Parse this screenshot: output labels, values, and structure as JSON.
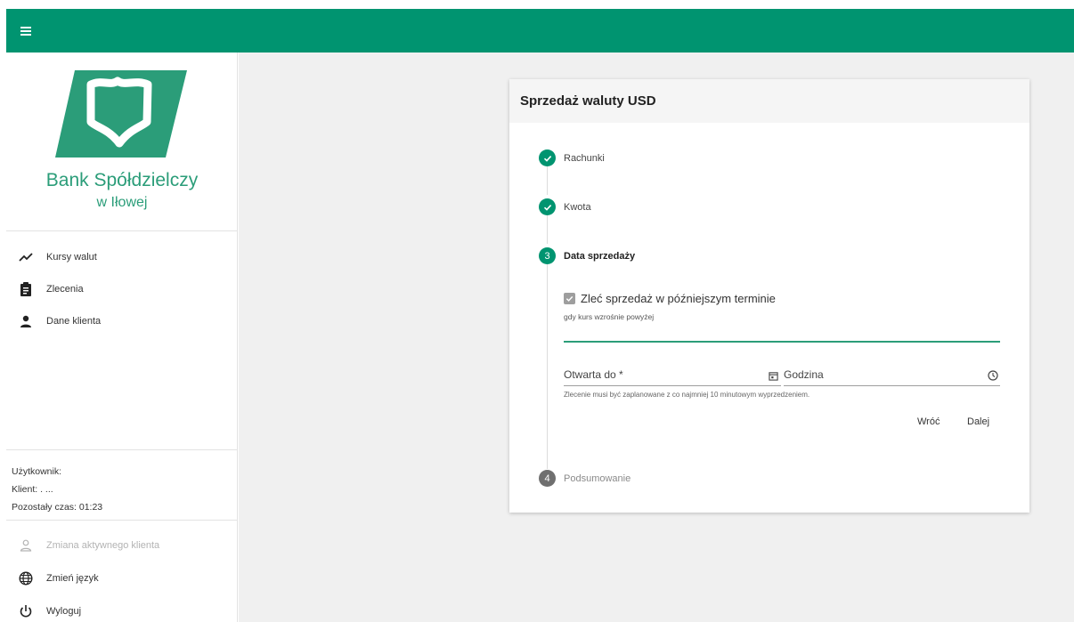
{
  "header": {
    "menu_icon": "hamburger-menu-icon",
    "brand_color": "#009470"
  },
  "sidebar": {
    "bank_name": "Bank Spółdzielczy",
    "bank_location": "w Iłowej",
    "nav": [
      {
        "label": "Kursy walut",
        "icon": "trend-chart-icon"
      },
      {
        "label": "Zlecenia",
        "icon": "clipboard-icon"
      },
      {
        "label": "Dane klienta",
        "icon": "person-icon"
      }
    ],
    "user": {
      "user_label": "Użytkownik:",
      "client_label": "Klient: . ...",
      "time_label": "Pozostały czas: 01:23"
    },
    "bottom_nav": [
      {
        "label": "Zmiana aktywnego klienta",
        "icon": "person-outline-icon",
        "disabled": true
      },
      {
        "label": "Zmień język",
        "icon": "globe-icon"
      },
      {
        "label": "Wyloguj",
        "icon": "power-icon"
      }
    ]
  },
  "card": {
    "title": "Sprzedaż waluty USD",
    "steps": [
      {
        "label": "Rachunki",
        "state": "done"
      },
      {
        "label": "Kwota",
        "state": "done"
      },
      {
        "number": "3",
        "label": "Data sprzedaży",
        "state": "active"
      },
      {
        "number": "4",
        "label": "Podsumowanie",
        "state": "pending"
      }
    ],
    "checkbox_label": "Zleć sprzedaż w późniejszym terminie",
    "checkbox_checked": true,
    "rate_hint": "gdy kurs wzrośnie powyżej",
    "rate_value": "",
    "date_field_label": "Otwarta do *",
    "time_field_label": "Godzina",
    "schedule_hint": "Zlecenie musi być zaplanowane z co najmniej 10 minutowym wyprzedzeniem.",
    "back_label": "Wróć",
    "next_label": "Dalej"
  }
}
